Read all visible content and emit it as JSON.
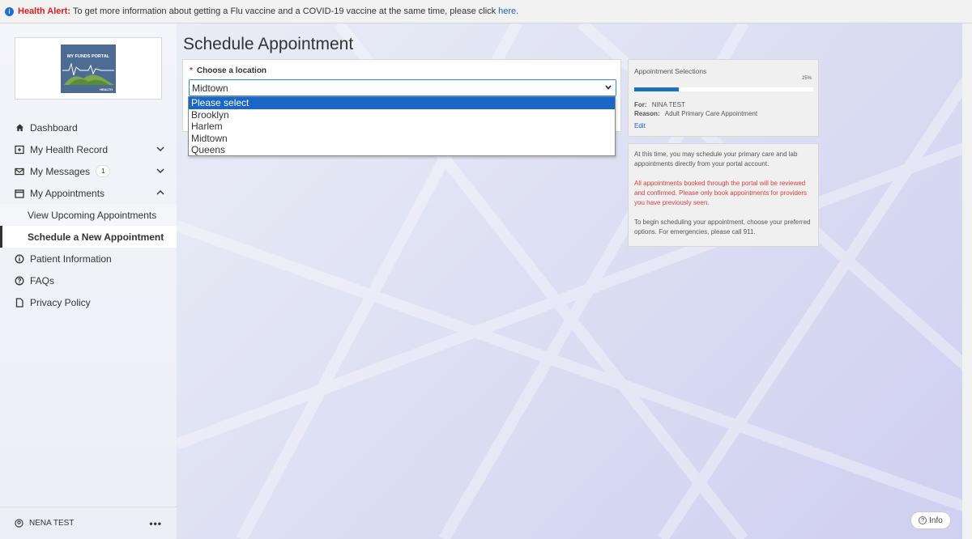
{
  "alert": {
    "title": "Health Alert:",
    "message": "To get more information about getting a Flu vaccine and a COVID-19 vaccine at the same time, please click",
    "link": "here."
  },
  "logo": {
    "title": "MY FUNDS PORTAL",
    "subtitle": "HEALTH"
  },
  "sidebar": {
    "items": [
      {
        "label": "Dashboard",
        "icon": "home-icon"
      },
      {
        "label": "My Health Record",
        "icon": "health-record-icon"
      },
      {
        "label": "My Messages",
        "icon": "mail-icon",
        "badge": "1"
      },
      {
        "label": "My Appointments",
        "icon": "calendar-icon"
      }
    ],
    "sub_items": [
      {
        "label": "View Upcoming Appointments"
      },
      {
        "label": "Schedule a New Appointment"
      }
    ],
    "lower_items": [
      {
        "label": "Patient Information",
        "icon": "info-icon"
      },
      {
        "label": "FAQs",
        "icon": "question-icon"
      },
      {
        "label": "Privacy Policy",
        "icon": "document-icon"
      }
    ],
    "user": "NENA TEST",
    "more": "•••"
  },
  "main": {
    "title": "Schedule Appointment",
    "location_label": "Choose a location",
    "required_mark": "*",
    "selected_value": "Midtown",
    "options": [
      "Please select",
      "Brooklyn",
      "Harlem",
      "Midtown",
      "Queens"
    ]
  },
  "selections": {
    "title": "Appointment Selections",
    "percent": "25%",
    "progress": 0.25,
    "for_label": "For:",
    "for_value": "NINA TEST",
    "reason_label": "Reason:",
    "reason_value": "Adult Primary Care Appointment",
    "edit": "Edit"
  },
  "info_panel": {
    "p1": "At this time, you may schedule your primary care and lab appointments directly from your portal account.",
    "p2": "All appointments booked through the portal will be reviewed and confirmed. Please only book appointments for providers you have previously seen.",
    "p3": "To begin scheduling your appointment, choose your preferred options. For emergencies, please call 911."
  },
  "info_button": "Info",
  "colors": {
    "accent": "#1a66c7",
    "alert_red": "#e21b1b",
    "progress": "#1e6fb7"
  }
}
